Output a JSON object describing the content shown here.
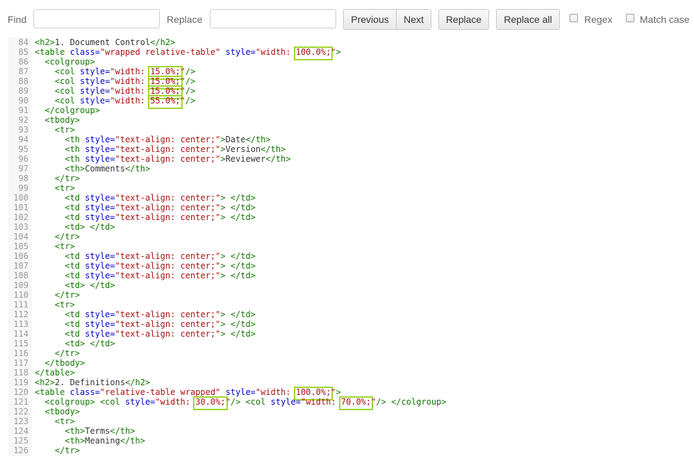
{
  "toolbar": {
    "find_label": "Find",
    "find_value": "",
    "replace_label": "Replace",
    "replace_value": "",
    "previous_label": "Previous",
    "next_label": "Next",
    "replace_button_label": "Replace",
    "replace_all_label": "Replace all",
    "regex_label": "Regex",
    "regex_checked": false,
    "match_case_label": "Match case",
    "match_case_checked": false
  },
  "colors": {
    "tag": "#117700",
    "attribute": "#0000cc",
    "string": "#aa1111",
    "highlight": "#9ed62b",
    "gutter_text": "#999999"
  },
  "code_lines": [
    {
      "n": "84",
      "segs": [
        {
          "t": "tag",
          "v": "<h2>"
        },
        {
          "t": "plain",
          "v": "1. Document Control"
        },
        {
          "t": "tag",
          "v": "</h2>"
        }
      ]
    },
    {
      "n": "85",
      "segs": [
        {
          "t": "tag",
          "v": "<table "
        },
        {
          "t": "attr",
          "v": "class="
        },
        {
          "t": "str",
          "v": "\"wrapped relative-table\""
        },
        {
          "t": "plain",
          "v": " "
        },
        {
          "t": "attr",
          "v": "style="
        },
        {
          "t": "str",
          "v": "\"width: "
        },
        {
          "t": "str",
          "v": "100.0%;",
          "hl": true
        },
        {
          "t": "str",
          "v": "\""
        },
        {
          "t": "tag",
          "v": ">"
        }
      ]
    },
    {
      "n": "86",
      "segs": [
        {
          "t": "plain",
          "v": "  "
        },
        {
          "t": "tag",
          "v": "<colgroup>"
        }
      ]
    },
    {
      "n": "87",
      "segs": [
        {
          "t": "plain",
          "v": "    "
        },
        {
          "t": "tag",
          "v": "<col "
        },
        {
          "t": "attr",
          "v": "style="
        },
        {
          "t": "str",
          "v": "\"width: "
        },
        {
          "t": "str",
          "v": "15.0%;",
          "hl": true
        },
        {
          "t": "str",
          "v": "\""
        },
        {
          "t": "tag",
          "v": "/>"
        }
      ]
    },
    {
      "n": "88",
      "segs": [
        {
          "t": "plain",
          "v": "    "
        },
        {
          "t": "tag",
          "v": "<col "
        },
        {
          "t": "attr",
          "v": "style="
        },
        {
          "t": "str",
          "v": "\"width: "
        },
        {
          "t": "str",
          "v": "15.0%;",
          "hl": true
        },
        {
          "t": "str",
          "v": "\""
        },
        {
          "t": "tag",
          "v": "/>"
        }
      ]
    },
    {
      "n": "89",
      "segs": [
        {
          "t": "plain",
          "v": "    "
        },
        {
          "t": "tag",
          "v": "<col "
        },
        {
          "t": "attr",
          "v": "style="
        },
        {
          "t": "str",
          "v": "\"width: "
        },
        {
          "t": "str",
          "v": "15.0%;",
          "hl": true
        },
        {
          "t": "str",
          "v": "\""
        },
        {
          "t": "tag",
          "v": "/>"
        }
      ]
    },
    {
      "n": "90",
      "segs": [
        {
          "t": "plain",
          "v": "    "
        },
        {
          "t": "tag",
          "v": "<col "
        },
        {
          "t": "attr",
          "v": "style="
        },
        {
          "t": "str",
          "v": "\"width: "
        },
        {
          "t": "str",
          "v": "55.0%;",
          "hl": true
        },
        {
          "t": "str",
          "v": "\""
        },
        {
          "t": "tag",
          "v": "/>"
        }
      ]
    },
    {
      "n": "91",
      "segs": [
        {
          "t": "plain",
          "v": "  "
        },
        {
          "t": "tag",
          "v": "</colgroup>"
        }
      ]
    },
    {
      "n": "92",
      "segs": [
        {
          "t": "plain",
          "v": "  "
        },
        {
          "t": "tag",
          "v": "<tbody>"
        }
      ]
    },
    {
      "n": "93",
      "segs": [
        {
          "t": "plain",
          "v": "    "
        },
        {
          "t": "tag",
          "v": "<tr>"
        }
      ]
    },
    {
      "n": "94",
      "segs": [
        {
          "t": "plain",
          "v": "      "
        },
        {
          "t": "tag",
          "v": "<th "
        },
        {
          "t": "attr",
          "v": "style="
        },
        {
          "t": "str",
          "v": "\"text-align: center;\""
        },
        {
          "t": "tag",
          "v": ">"
        },
        {
          "t": "plain",
          "v": "Date"
        },
        {
          "t": "tag",
          "v": "</th>"
        }
      ]
    },
    {
      "n": "95",
      "segs": [
        {
          "t": "plain",
          "v": "      "
        },
        {
          "t": "tag",
          "v": "<th "
        },
        {
          "t": "attr",
          "v": "style="
        },
        {
          "t": "str",
          "v": "\"text-align: center;\""
        },
        {
          "t": "tag",
          "v": ">"
        },
        {
          "t": "plain",
          "v": "Version"
        },
        {
          "t": "tag",
          "v": "</th>"
        }
      ]
    },
    {
      "n": "96",
      "segs": [
        {
          "t": "plain",
          "v": "      "
        },
        {
          "t": "tag",
          "v": "<th "
        },
        {
          "t": "attr",
          "v": "style="
        },
        {
          "t": "str",
          "v": "\"text-align: center;\""
        },
        {
          "t": "tag",
          "v": ">"
        },
        {
          "t": "plain",
          "v": "Reviewer"
        },
        {
          "t": "tag",
          "v": "</th>"
        }
      ]
    },
    {
      "n": "97",
      "segs": [
        {
          "t": "plain",
          "v": "      "
        },
        {
          "t": "tag",
          "v": "<th>"
        },
        {
          "t": "plain",
          "v": "Comments"
        },
        {
          "t": "tag",
          "v": "</th>"
        }
      ]
    },
    {
      "n": "98",
      "segs": [
        {
          "t": "plain",
          "v": "    "
        },
        {
          "t": "tag",
          "v": "</tr>"
        }
      ]
    },
    {
      "n": "99",
      "segs": [
        {
          "t": "plain",
          "v": "    "
        },
        {
          "t": "tag",
          "v": "<tr>"
        }
      ]
    },
    {
      "n": "100",
      "segs": [
        {
          "t": "plain",
          "v": "      "
        },
        {
          "t": "tag",
          "v": "<td "
        },
        {
          "t": "attr",
          "v": "style="
        },
        {
          "t": "str",
          "v": "\"text-align: center;\""
        },
        {
          "t": "tag",
          "v": ">"
        },
        {
          "t": "plain",
          "v": " "
        },
        {
          "t": "tag",
          "v": "</td>"
        }
      ]
    },
    {
      "n": "101",
      "segs": [
        {
          "t": "plain",
          "v": "      "
        },
        {
          "t": "tag",
          "v": "<td "
        },
        {
          "t": "attr",
          "v": "style="
        },
        {
          "t": "str",
          "v": "\"text-align: center;\""
        },
        {
          "t": "tag",
          "v": ">"
        },
        {
          "t": "plain",
          "v": " "
        },
        {
          "t": "tag",
          "v": "</td>"
        }
      ]
    },
    {
      "n": "102",
      "segs": [
        {
          "t": "plain",
          "v": "      "
        },
        {
          "t": "tag",
          "v": "<td "
        },
        {
          "t": "attr",
          "v": "style="
        },
        {
          "t": "str",
          "v": "\"text-align: center;\""
        },
        {
          "t": "tag",
          "v": ">"
        },
        {
          "t": "plain",
          "v": " "
        },
        {
          "t": "tag",
          "v": "</td>"
        }
      ]
    },
    {
      "n": "103",
      "segs": [
        {
          "t": "plain",
          "v": "      "
        },
        {
          "t": "tag",
          "v": "<td>"
        },
        {
          "t": "plain",
          "v": " "
        },
        {
          "t": "tag",
          "v": "</td>"
        }
      ]
    },
    {
      "n": "104",
      "segs": [
        {
          "t": "plain",
          "v": "    "
        },
        {
          "t": "tag",
          "v": "</tr>"
        }
      ]
    },
    {
      "n": "105",
      "segs": [
        {
          "t": "plain",
          "v": "    "
        },
        {
          "t": "tag",
          "v": "<tr>"
        }
      ]
    },
    {
      "n": "106",
      "segs": [
        {
          "t": "plain",
          "v": "      "
        },
        {
          "t": "tag",
          "v": "<td "
        },
        {
          "t": "attr",
          "v": "style="
        },
        {
          "t": "str",
          "v": "\"text-align: center;\""
        },
        {
          "t": "tag",
          "v": ">"
        },
        {
          "t": "plain",
          "v": " "
        },
        {
          "t": "tag",
          "v": "</td>"
        }
      ]
    },
    {
      "n": "107",
      "segs": [
        {
          "t": "plain",
          "v": "      "
        },
        {
          "t": "tag",
          "v": "<td "
        },
        {
          "t": "attr",
          "v": "style="
        },
        {
          "t": "str",
          "v": "\"text-align: center;\""
        },
        {
          "t": "tag",
          "v": ">"
        },
        {
          "t": "plain",
          "v": " "
        },
        {
          "t": "tag",
          "v": "</td>"
        }
      ]
    },
    {
      "n": "108",
      "segs": [
        {
          "t": "plain",
          "v": "      "
        },
        {
          "t": "tag",
          "v": "<td "
        },
        {
          "t": "attr",
          "v": "style="
        },
        {
          "t": "str",
          "v": "\"text-align: center;\""
        },
        {
          "t": "tag",
          "v": ">"
        },
        {
          "t": "plain",
          "v": " "
        },
        {
          "t": "tag",
          "v": "</td>"
        }
      ]
    },
    {
      "n": "109",
      "segs": [
        {
          "t": "plain",
          "v": "      "
        },
        {
          "t": "tag",
          "v": "<td>"
        },
        {
          "t": "plain",
          "v": " "
        },
        {
          "t": "tag",
          "v": "</td>"
        }
      ]
    },
    {
      "n": "110",
      "segs": [
        {
          "t": "plain",
          "v": "    "
        },
        {
          "t": "tag",
          "v": "</tr>"
        }
      ]
    },
    {
      "n": "111",
      "segs": [
        {
          "t": "plain",
          "v": "    "
        },
        {
          "t": "tag",
          "v": "<tr>"
        }
      ]
    },
    {
      "n": "112",
      "segs": [
        {
          "t": "plain",
          "v": "      "
        },
        {
          "t": "tag",
          "v": "<td "
        },
        {
          "t": "attr",
          "v": "style="
        },
        {
          "t": "str",
          "v": "\"text-align: center;\""
        },
        {
          "t": "tag",
          "v": ">"
        },
        {
          "t": "plain",
          "v": " "
        },
        {
          "t": "tag",
          "v": "</td>"
        }
      ]
    },
    {
      "n": "113",
      "segs": [
        {
          "t": "plain",
          "v": "      "
        },
        {
          "t": "tag",
          "v": "<td "
        },
        {
          "t": "attr",
          "v": "style="
        },
        {
          "t": "str",
          "v": "\"text-align: center;\""
        },
        {
          "t": "tag",
          "v": ">"
        },
        {
          "t": "plain",
          "v": " "
        },
        {
          "t": "tag",
          "v": "</td>"
        }
      ]
    },
    {
      "n": "114",
      "segs": [
        {
          "t": "plain",
          "v": "      "
        },
        {
          "t": "tag",
          "v": "<td "
        },
        {
          "t": "attr",
          "v": "style="
        },
        {
          "t": "str",
          "v": "\"text-align: center;\""
        },
        {
          "t": "tag",
          "v": ">"
        },
        {
          "t": "plain",
          "v": " "
        },
        {
          "t": "tag",
          "v": "</td>"
        }
      ]
    },
    {
      "n": "115",
      "segs": [
        {
          "t": "plain",
          "v": "      "
        },
        {
          "t": "tag",
          "v": "<td>"
        },
        {
          "t": "plain",
          "v": " "
        },
        {
          "t": "tag",
          "v": "</td>"
        }
      ]
    },
    {
      "n": "116",
      "segs": [
        {
          "t": "plain",
          "v": "    "
        },
        {
          "t": "tag",
          "v": "</tr>"
        }
      ]
    },
    {
      "n": "117",
      "segs": [
        {
          "t": "plain",
          "v": "  "
        },
        {
          "t": "tag",
          "v": "</tbody>"
        }
      ]
    },
    {
      "n": "118",
      "segs": [
        {
          "t": "tag",
          "v": "</table>"
        }
      ]
    },
    {
      "n": "119",
      "segs": [
        {
          "t": "tag",
          "v": "<h2>"
        },
        {
          "t": "plain",
          "v": "2. Definitions"
        },
        {
          "t": "tag",
          "v": "</h2>"
        }
      ]
    },
    {
      "n": "120",
      "segs": [
        {
          "t": "tag",
          "v": "<table "
        },
        {
          "t": "attr",
          "v": "class="
        },
        {
          "t": "str",
          "v": "\"relative-table wrapped\""
        },
        {
          "t": "plain",
          "v": " "
        },
        {
          "t": "attr",
          "v": "style="
        },
        {
          "t": "str",
          "v": "\"width: "
        },
        {
          "t": "str",
          "v": "100.0%;",
          "hl": true
        },
        {
          "t": "str",
          "v": "\""
        },
        {
          "t": "tag",
          "v": ">"
        }
      ]
    },
    {
      "n": "121",
      "segs": [
        {
          "t": "plain",
          "v": "  "
        },
        {
          "t": "tag",
          "v": "<colgroup>"
        },
        {
          "t": "plain",
          "v": " "
        },
        {
          "t": "tag",
          "v": "<col "
        },
        {
          "t": "attr",
          "v": "style="
        },
        {
          "t": "str",
          "v": "\"width: "
        },
        {
          "t": "str",
          "v": "30.0%;",
          "hl": true
        },
        {
          "t": "str",
          "v": "\""
        },
        {
          "t": "tag",
          "v": "/>"
        },
        {
          "t": "plain",
          "v": " "
        },
        {
          "t": "tag",
          "v": "<col "
        },
        {
          "t": "attr",
          "v": "style="
        },
        {
          "t": "str",
          "v": "\"width: "
        },
        {
          "t": "str",
          "v": "70.0%;",
          "hl": true
        },
        {
          "t": "str",
          "v": "\""
        },
        {
          "t": "tag",
          "v": "/>"
        },
        {
          "t": "plain",
          "v": " "
        },
        {
          "t": "tag",
          "v": "</colgroup>"
        }
      ]
    },
    {
      "n": "122",
      "segs": [
        {
          "t": "plain",
          "v": "  "
        },
        {
          "t": "tag",
          "v": "<tbody>"
        }
      ]
    },
    {
      "n": "123",
      "segs": [
        {
          "t": "plain",
          "v": "    "
        },
        {
          "t": "tag",
          "v": "<tr>"
        }
      ]
    },
    {
      "n": "124",
      "segs": [
        {
          "t": "plain",
          "v": "      "
        },
        {
          "t": "tag",
          "v": "<th>"
        },
        {
          "t": "plain",
          "v": "Terms"
        },
        {
          "t": "tag",
          "v": "</th>"
        }
      ]
    },
    {
      "n": "125",
      "segs": [
        {
          "t": "plain",
          "v": "      "
        },
        {
          "t": "tag",
          "v": "<th>"
        },
        {
          "t": "plain",
          "v": "Meaning"
        },
        {
          "t": "tag",
          "v": "</th>"
        }
      ]
    },
    {
      "n": "126",
      "segs": [
        {
          "t": "plain",
          "v": "    "
        },
        {
          "t": "tag",
          "v": "</tr>"
        }
      ]
    }
  ]
}
